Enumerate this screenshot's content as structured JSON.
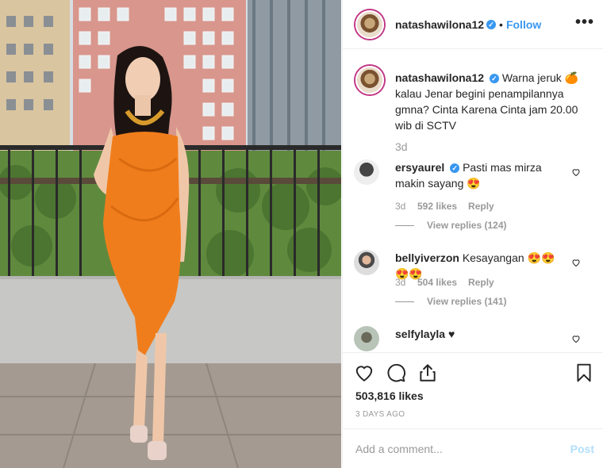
{
  "post": {
    "username": "natashawilona12",
    "verified_mark": "✓",
    "separator": "•",
    "follow_label": "Follow",
    "more_label": "•••"
  },
  "caption": {
    "username": "natashawilona12",
    "text": "Warna jeruk 🍊 kalau Jenar begini penampilannya gmna? Cinta Karena Cinta jam 20.00 wib di SCTV",
    "time": "3d"
  },
  "comments": [
    {
      "username": "ersyaurel",
      "verified": true,
      "text": "Pasti mas mirza makin sayang 😍",
      "time": "3d",
      "likes": "592 likes",
      "reply_label": "Reply",
      "view_replies": "View replies (124)"
    },
    {
      "username": "bellyiverzon",
      "verified": false,
      "text": "Kesayangan 😍😍😍😍",
      "time": "3d",
      "likes": "504 likes",
      "reply_label": "Reply",
      "view_replies": "View replies (141)"
    },
    {
      "username": "selfylayla",
      "verified": false,
      "text": "♥"
    }
  ],
  "actions": {
    "likes": "503,816 likes",
    "time_ago": "3 DAYS AGO"
  },
  "add_comment": {
    "placeholder": "Add a comment...",
    "post_label": "Post"
  },
  "colors": {
    "accent": "#3897f0",
    "dress": "#f07d1c",
    "post_disabled": "#b2dffc"
  },
  "icons": [
    "heart-icon",
    "comment-icon",
    "share-icon",
    "bookmark-icon",
    "more-icon",
    "verified-icon"
  ]
}
